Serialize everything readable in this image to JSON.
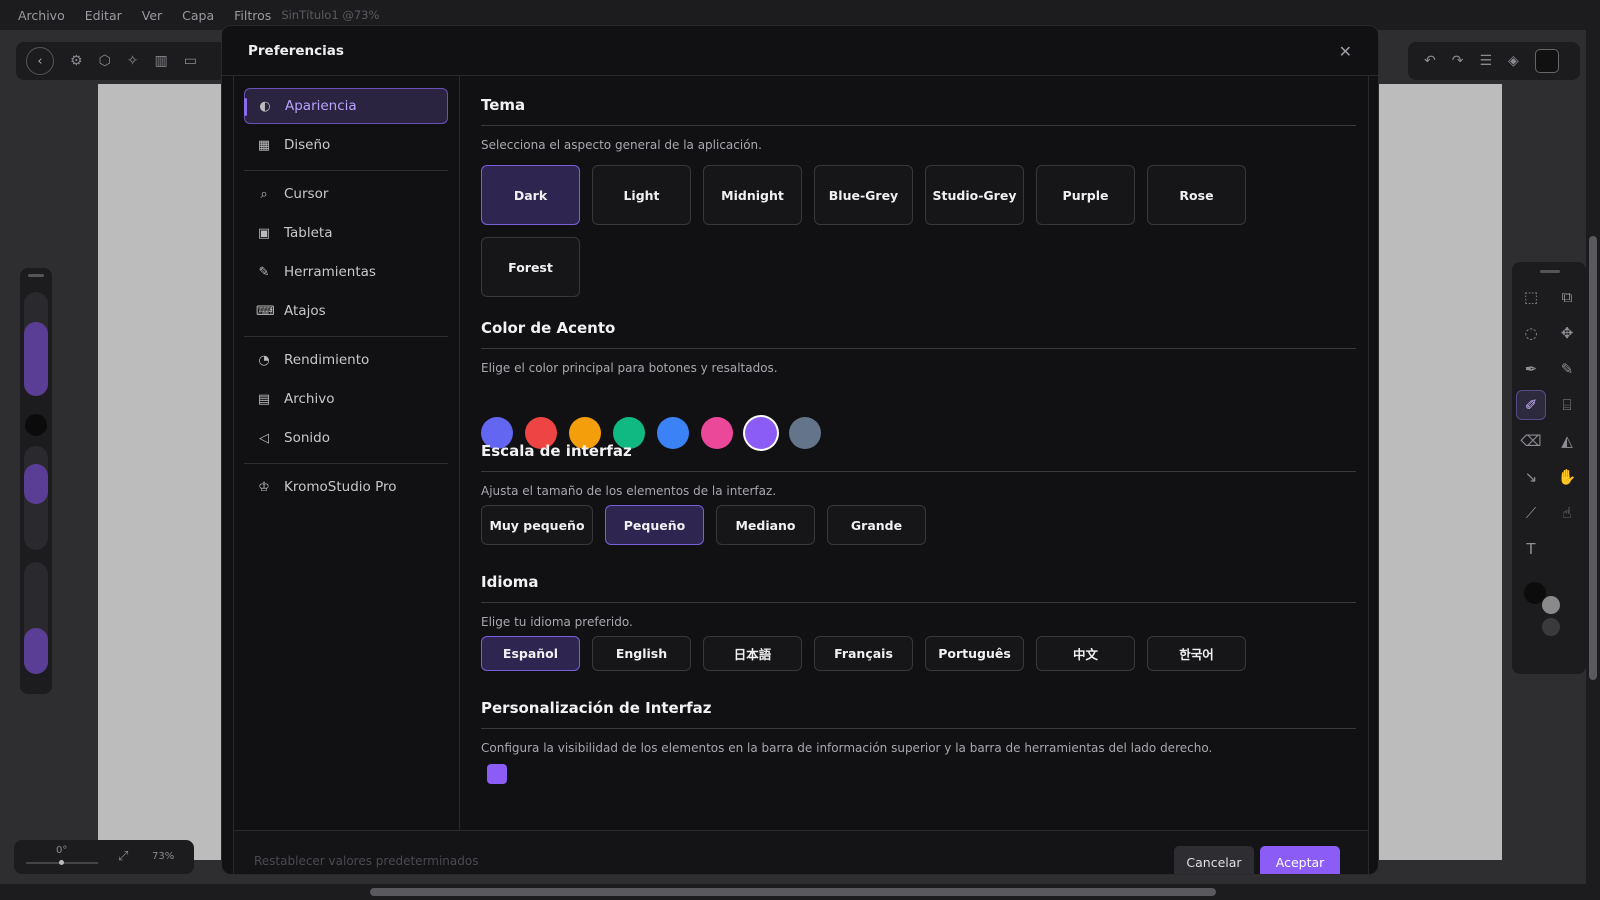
{
  "menubar": {
    "items": [
      "Archivo",
      "Editar",
      "Ver",
      "Capa",
      "Filtros"
    ],
    "document": "SinTítulo1 @73%"
  },
  "status": {
    "angle": "0°",
    "zoom": "73%"
  },
  "dialog": {
    "title": "Preferencias",
    "nav": [
      {
        "label": "Apariencia",
        "icon": "palette-icon"
      },
      {
        "label": "Diseño",
        "icon": "layout-icon"
      },
      {
        "label": "Cursor",
        "icon": "cursor-search-icon"
      },
      {
        "label": "Tableta",
        "icon": "tablet-icon"
      },
      {
        "label": "Herramientas",
        "icon": "brush-icon"
      },
      {
        "label": "Atajos",
        "icon": "keyboard-icon"
      },
      {
        "label": "Rendimiento",
        "icon": "gauge-icon"
      },
      {
        "label": "Archivo",
        "icon": "file-icon"
      },
      {
        "label": "Sonido",
        "icon": "speaker-icon"
      },
      {
        "label": "KromoStudio Pro",
        "icon": "crown-icon"
      }
    ],
    "sections": {
      "theme": {
        "title": "Tema",
        "desc": "Selecciona el aspecto general de la aplicación.",
        "options": [
          "Dark",
          "Light",
          "Midnight",
          "Blue-Grey",
          "Studio-Grey",
          "Purple",
          "Rose",
          "Forest"
        ],
        "selected": "Dark"
      },
      "accent": {
        "title": "Color de Acento",
        "desc": "Elige el color principal para botones y resaltados.",
        "colors": [
          "#6366f1",
          "#ef4444",
          "#f59e0b",
          "#10b981",
          "#3b82f6",
          "#ec4899",
          "#8b5cf6",
          "#64748b"
        ],
        "selected": "#8b5cf6"
      },
      "scale": {
        "title": "Escala de interfaz",
        "desc": "Ajusta el tamaño de los elementos de la interfaz.",
        "options": [
          "Muy pequeño",
          "Pequeño",
          "Mediano",
          "Grande"
        ],
        "selected": "Pequeño"
      },
      "language": {
        "title": "Idioma",
        "desc": "Elige tu idioma preferido.",
        "options": [
          "Español",
          "English",
          "日本語",
          "Français",
          "Português",
          "中文",
          "한국어"
        ],
        "selected": "Español"
      },
      "custom": {
        "title": "Personalización de Interfaz",
        "desc": "Configura la visibilidad de los elementos en la barra de información superior y la barra de herramientas del lado derecho."
      }
    },
    "footer": {
      "reset": "Restablecer valores predeterminados",
      "cancel": "Cancelar",
      "accept": "Aceptar"
    }
  }
}
